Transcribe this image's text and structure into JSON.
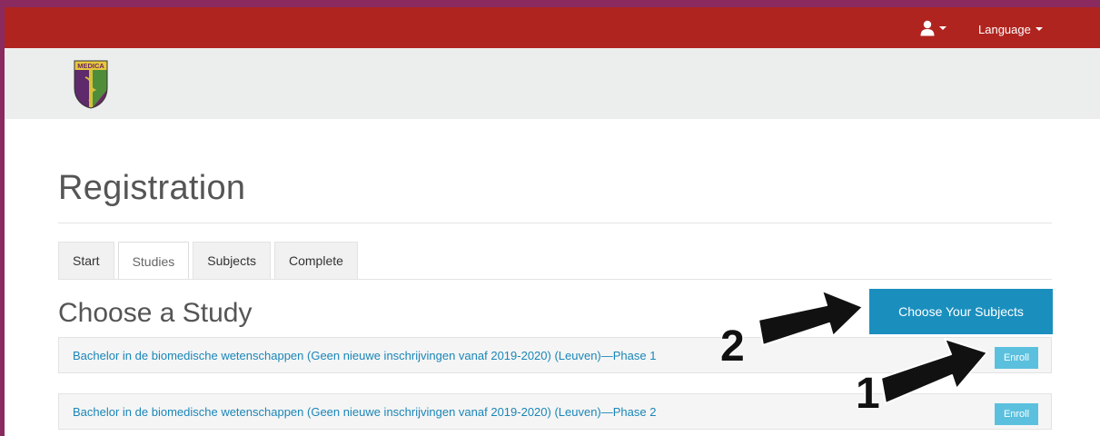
{
  "topbar": {
    "user_icon": "user-icon",
    "language_label": "Language",
    "color": "#b0241f"
  },
  "logo": {
    "text": "MEDICA"
  },
  "page": {
    "title": "Registration"
  },
  "tabs": [
    {
      "label": "Start",
      "active": false
    },
    {
      "label": "Studies",
      "active": true
    },
    {
      "label": "Subjects",
      "active": false
    },
    {
      "label": "Complete",
      "active": false
    }
  ],
  "section": {
    "title": "Choose a Study",
    "choose_subjects_label": "Choose Your Subjects"
  },
  "studies": [
    {
      "label": "Bachelor in de biomedische wetenschappen (Geen nieuwe inschrijvingen vanaf 2019-2020) (Leuven)—Phase 1",
      "enroll_label": "Enroll"
    },
    {
      "label": "Bachelor in de biomedische wetenschappen (Geen nieuwe inschrijvingen vanaf 2019-2020) (Leuven)—Phase 2",
      "enroll_label": "Enroll"
    }
  ],
  "annotations": [
    {
      "number": "1"
    },
    {
      "number": "2"
    }
  ],
  "colors": {
    "accent": "#1a8fbe",
    "enroll": "#5bc0de",
    "link": "#1a86b8",
    "page_border": "#8a2a5e"
  }
}
